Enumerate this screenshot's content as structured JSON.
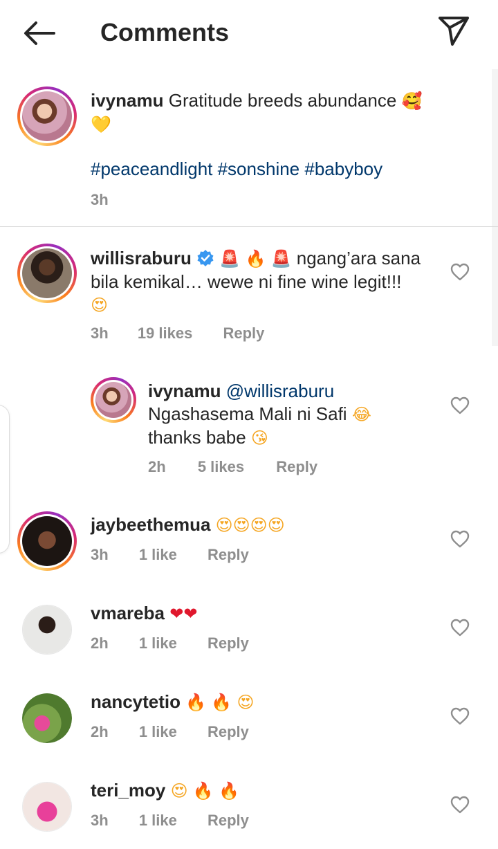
{
  "header": {
    "title": "Comments"
  },
  "caption": {
    "username": "ivynamu",
    "text": "Gratitude breeds abundance",
    "emoji_1": "🥰",
    "emoji_2": "💛",
    "hashtags": "#peaceandlight #sonshine #babyboy",
    "time": "3h"
  },
  "comments": [
    {
      "username": "willisraburu",
      "emojis_lead": [
        "🚨",
        "🔥",
        "🚨"
      ],
      "text": "ngang’ara sana bila kemikal… wewe ni fine wine legit!!!",
      "emoji_tail": "😍",
      "time": "3h",
      "likes": "19 likes",
      "reply": "Reply"
    },
    {
      "username": "ivynamu",
      "mention": "@willisraburu",
      "text_1": "Ngashasema Mali ni Safi",
      "emoji_1": "😂",
      "text_2": "thanks babe",
      "emoji_2": "😘",
      "time": "2h",
      "likes": "5 likes",
      "reply": "Reply"
    },
    {
      "username": "jaybeethemua",
      "emojis": "😍😍😍😍",
      "time": "3h",
      "likes": "1 like",
      "reply": "Reply"
    },
    {
      "username": "vmareba",
      "emojis": "❤❤",
      "time": "2h",
      "likes": "1 like",
      "reply": "Reply"
    },
    {
      "username": "nancytetio",
      "emojis": [
        "🔥",
        "🔥",
        "😍"
      ],
      "time": "2h",
      "likes": "1 like",
      "reply": "Reply"
    },
    {
      "username": "teri_moy",
      "emojis": [
        "😍",
        "🔥",
        "🔥"
      ],
      "time": "3h",
      "likes": "1 like",
      "reply": "Reply"
    }
  ]
}
